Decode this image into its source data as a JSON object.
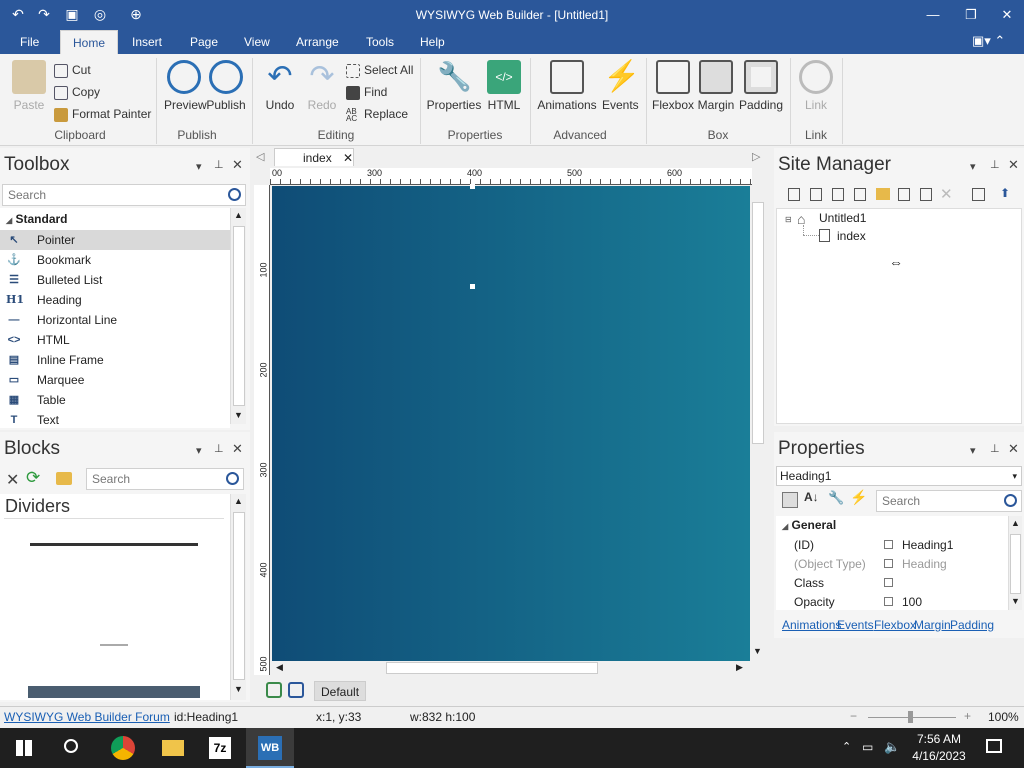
{
  "window": {
    "title": "WYSIWYG Web Builder - [Untitled1]"
  },
  "menu": {
    "tabs": [
      "File",
      "Home",
      "Insert",
      "Page",
      "View",
      "Arrange",
      "Tools",
      "Help"
    ]
  },
  "ribbon": {
    "clipboard": {
      "paste": "Paste",
      "cut": "Cut",
      "copy": "Copy",
      "format_painter": "Format Painter",
      "group": "Clipboard"
    },
    "publish": {
      "preview": "Preview",
      "publish": "Publish",
      "group": "Publish"
    },
    "editing": {
      "undo": "Undo",
      "redo": "Redo",
      "select_all": "Select All",
      "find": "Find",
      "replace": "Replace",
      "group": "Editing"
    },
    "properties": {
      "properties": "Properties",
      "html": "HTML",
      "group": "Properties"
    },
    "advanced": {
      "animations": "Animations",
      "events": "Events",
      "group": "Advanced"
    },
    "box": {
      "flexbox": "Flexbox",
      "margin": "Margin",
      "padding": "Padding",
      "group": "Box"
    },
    "link": {
      "link": "Link",
      "group": "Link"
    }
  },
  "toolbox": {
    "title": "Toolbox",
    "search_placeholder": "Search",
    "category": "Standard",
    "items": [
      {
        "label": "Pointer",
        "icon": "pointer-icon"
      },
      {
        "label": "Bookmark",
        "icon": "anchor-icon"
      },
      {
        "label": "Bulleted List",
        "icon": "list-icon"
      },
      {
        "label": "Heading",
        "icon": "heading-icon"
      },
      {
        "label": "Horizontal Line",
        "icon": "line-icon"
      },
      {
        "label": "HTML",
        "icon": "code-icon"
      },
      {
        "label": "Inline Frame",
        "icon": "frame-icon"
      },
      {
        "label": "Marquee",
        "icon": "marquee-icon"
      },
      {
        "label": "Table",
        "icon": "table-icon"
      },
      {
        "label": "Text",
        "icon": "text-icon"
      }
    ]
  },
  "blocks": {
    "title": "Blocks",
    "search_placeholder": "Search",
    "section": "Dividers"
  },
  "editor": {
    "tab": "index",
    "ruler_h": [
      "00",
      "300",
      "400",
      "500",
      "600"
    ],
    "ruler_v": [
      "100",
      "200",
      "300",
      "400",
      "500"
    ],
    "bottom_label": "Default",
    "canvas_color_start": "#0f4c76",
    "canvas_color_end": "#1a7e98"
  },
  "site_manager": {
    "title": "Site Manager",
    "root": "Untitled1",
    "page": "index"
  },
  "properties": {
    "title": "Properties",
    "selected": "Heading1",
    "search_placeholder": "Search",
    "group": "General",
    "rows": [
      {
        "name": "(ID)",
        "value": "Heading1"
      },
      {
        "name": "(Object Type)",
        "value": "Heading"
      },
      {
        "name": "Class",
        "value": ""
      },
      {
        "name": "Opacity",
        "value": "100"
      }
    ],
    "links": [
      "Animations",
      "Events",
      "Flexbox",
      "Margin",
      "Padding"
    ]
  },
  "statusbar": {
    "forum": "WYSIWYG Web Builder Forum",
    "id": "id:Heading1",
    "coords": "x:1, y:33",
    "size": "w:832 h:100",
    "zoom": "100%"
  },
  "taskbar": {
    "time": "7:56 AM",
    "date": "4/16/2023"
  },
  "colors": {
    "accent": "#2b579a",
    "link": "#1a5fb4"
  }
}
